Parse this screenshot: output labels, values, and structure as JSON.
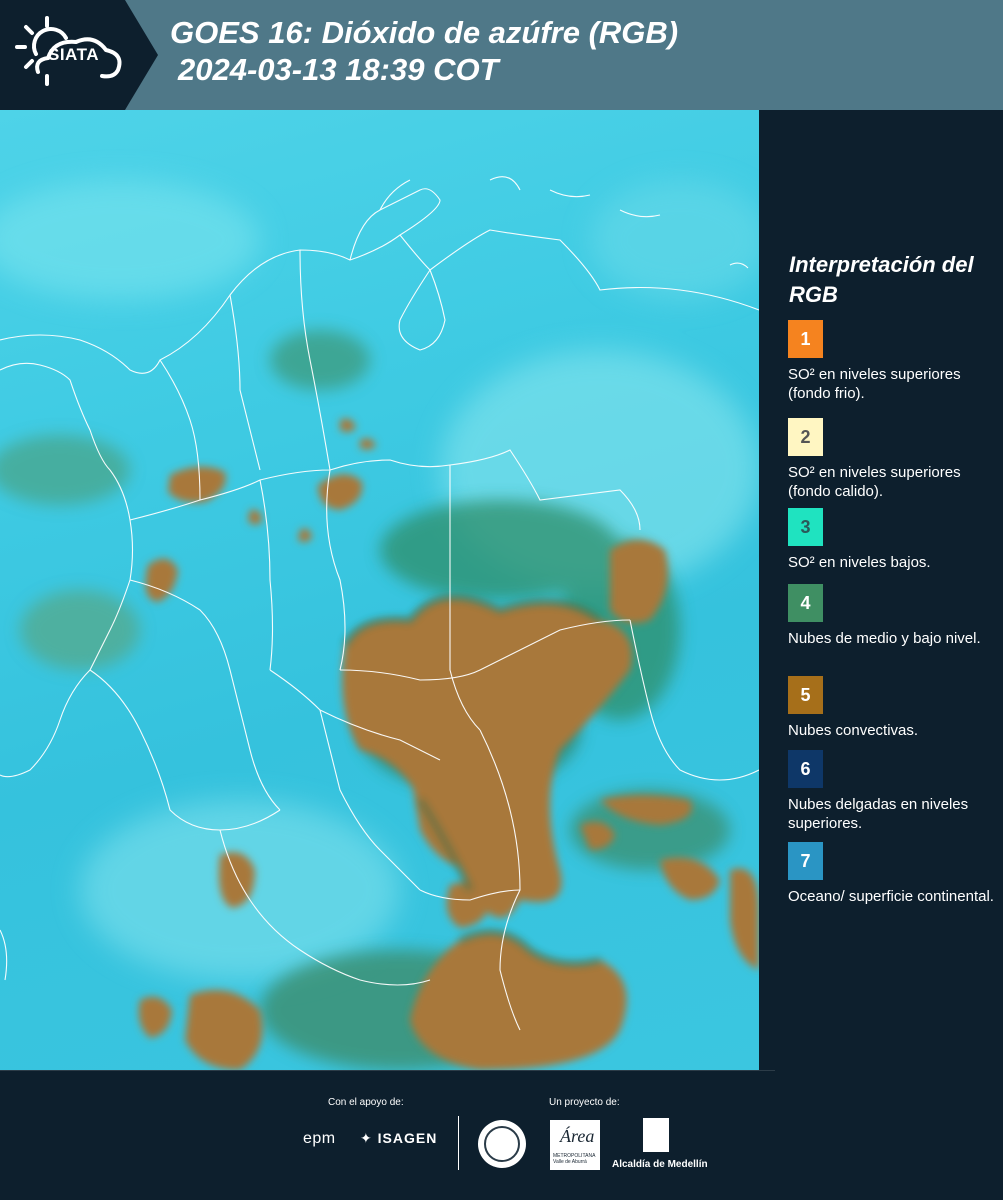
{
  "header": {
    "logo_text": "SIATA",
    "title_line1": "GOES 16: Dióxido de azúfre (RGB)",
    "title_line2": "2024-03-13 18:39 COT"
  },
  "map": {
    "description_icon": "satellite-rgb-image",
    "colors": {
      "background_surface": "#3fcbe3",
      "convective_clouds": "#a8783a",
      "mid_low_clouds": "#2f8f6a",
      "borders": "#ffffff"
    }
  },
  "legend": {
    "title": "Interpretación del RGB",
    "items": [
      {
        "number": "1",
        "color": "#f5831f",
        "text": "SO² en niveles superiores (fondo frio)."
      },
      {
        "number": "2",
        "color": "#fff6c2",
        "text": "SO² en niveles superiores (fondo calido)."
      },
      {
        "number": "3",
        "color": "#1fe3c0",
        "text": "SO² en niveles bajos."
      },
      {
        "number": "4",
        "color": "#3f8f63",
        "text": "Nubes de medio y bajo nivel."
      },
      {
        "number": "5",
        "color": "#a66f1a",
        "text": "Nubes convectivas."
      },
      {
        "number": "6",
        "color": "#0e3768",
        "text": "Nubes delgadas en niveles superiores."
      },
      {
        "number": "7",
        "color": "#2a95c4",
        "text": "Oceano/ superficie continental."
      }
    ]
  },
  "footer": {
    "support_label": "Con el apoyo de:",
    "project_label": "Un proyecto de:",
    "sponsor1": "epm",
    "sponsor2": "ISAGEN",
    "partner_area": "Área",
    "partner_area_sub": "METROPOLITANA Valle de Aburrá",
    "partner_alcaldia": "Alcaldía de Medellín"
  }
}
